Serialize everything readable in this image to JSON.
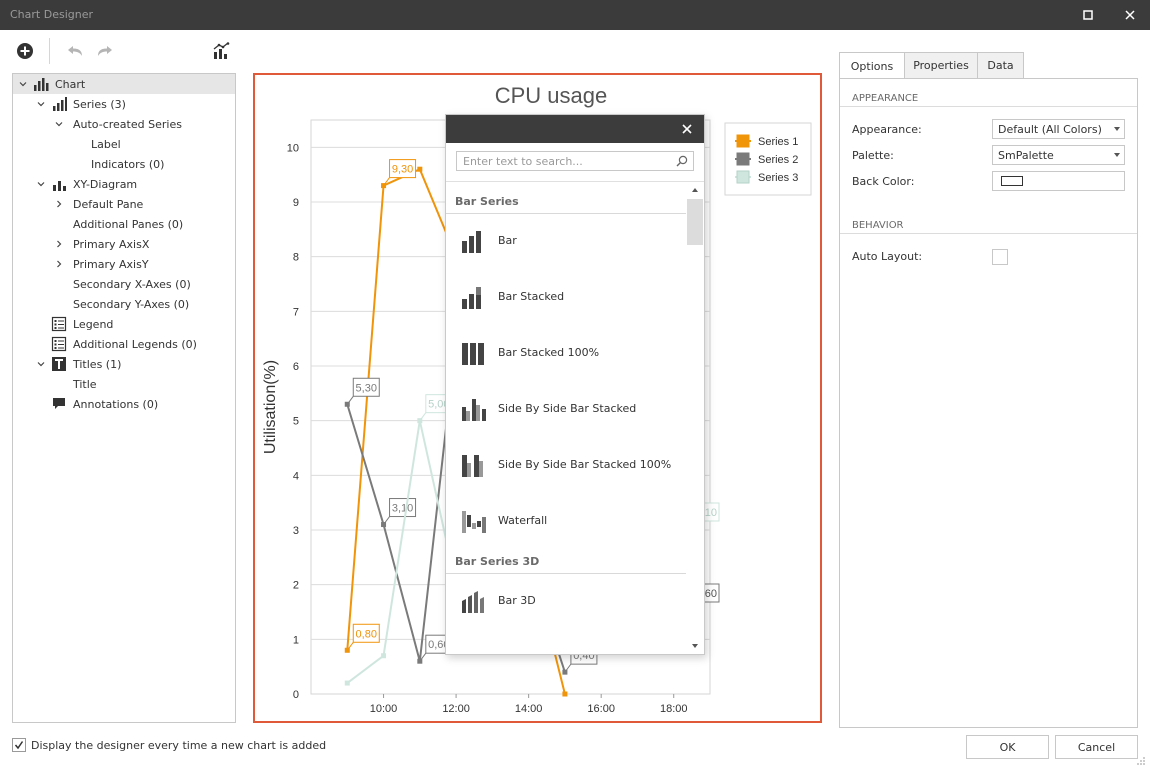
{
  "window": {
    "title": "Chart Designer"
  },
  "tree": {
    "items": [
      {
        "label": "Chart",
        "icon": "chart-icon",
        "level": 0,
        "expanded": true,
        "selected": true
      },
      {
        "label": "Series (3)",
        "icon": "bar-series-icon",
        "level": 1,
        "expanded": true
      },
      {
        "label": "Auto-created Series",
        "icon": "",
        "level": 2,
        "expanded": true
      },
      {
        "label": "Label",
        "icon": "",
        "level": 3
      },
      {
        "label": "Indicators (0)",
        "icon": "",
        "level": 3
      },
      {
        "label": "XY-Diagram",
        "icon": "xy-diagram-icon",
        "level": 1,
        "expanded": true
      },
      {
        "label": "Default Pane",
        "icon": "",
        "level": 2,
        "collapsed": true
      },
      {
        "label": "Additional Panes (0)",
        "icon": "",
        "level": 2
      },
      {
        "label": "Primary AxisX",
        "icon": "",
        "level": 2,
        "collapsed": true
      },
      {
        "label": "Primary AxisY",
        "icon": "",
        "level": 2,
        "collapsed": true
      },
      {
        "label": "Secondary X-Axes (0)",
        "icon": "",
        "level": 2
      },
      {
        "label": "Secondary Y-Axes (0)",
        "icon": "",
        "level": 2
      },
      {
        "label": "Legend",
        "icon": "legend-icon",
        "level": 1
      },
      {
        "label": "Additional Legends (0)",
        "icon": "legend-icon",
        "level": 1
      },
      {
        "label": "Titles (1)",
        "icon": "title-icon",
        "level": 1,
        "expanded": true
      },
      {
        "label": "Title",
        "icon": "",
        "level": 2
      },
      {
        "label": "Annotations (0)",
        "icon": "annotation-icon",
        "level": 1
      }
    ]
  },
  "chart_data": {
    "type": "line",
    "title": "CPU usage",
    "xlabel": "",
    "ylabel": "Utilisation(%)",
    "ylim": [
      0,
      10.5
    ],
    "xlim": [
      8,
      19
    ],
    "yticks": [
      "0",
      "1",
      "2",
      "3",
      "4",
      "5",
      "6",
      "7",
      "8",
      "9",
      "10"
    ],
    "xticks": [
      {
        "v": 10,
        "label": "10:00"
      },
      {
        "v": 12,
        "label": "12:00"
      },
      {
        "v": 14,
        "label": "14:00"
      },
      {
        "v": 16,
        "label": "16:00"
      },
      {
        "v": 18,
        "label": "18:00"
      }
    ],
    "grid": true,
    "legend": "top-right",
    "series": [
      {
        "name": "Series 1",
        "color": "#f0940a",
        "points": [
          {
            "x": 9,
            "y": 0.8,
            "label": "0,80"
          },
          {
            "x": 10,
            "y": 9.3,
            "label": "9,30"
          },
          {
            "x": 11,
            "y": 9.6,
            "label": ""
          },
          {
            "x": 12,
            "y": 8.0,
            "label": ""
          },
          {
            "x": 15,
            "y": 0.0,
            "label": ""
          }
        ]
      },
      {
        "name": "Series 2",
        "color": "#7a7a7a",
        "points": [
          {
            "x": 9,
            "y": 5.3,
            "label": "5,30"
          },
          {
            "x": 10,
            "y": 3.1,
            "label": "3,10"
          },
          {
            "x": 11,
            "y": 0.6,
            "label": "0,60"
          },
          {
            "x": 12,
            "y": 6.5,
            "label": ""
          },
          {
            "x": 15,
            "y": 0.4,
            "label": "0,40"
          }
        ]
      },
      {
        "name": "Series 3",
        "color": "#cfe6df",
        "points": [
          {
            "x": 9,
            "y": 0.2,
            "label": ""
          },
          {
            "x": 10,
            "y": 0.7,
            "label": ""
          },
          {
            "x": 11,
            "y": 5.0,
            "label": "5,00"
          },
          {
            "x": 12,
            "y": 2.0,
            "label": ""
          }
        ]
      }
    ],
    "partial_labels": [
      "10",
      "60"
    ]
  },
  "picker": {
    "search_placeholder": "Enter text to search...",
    "groups": [
      {
        "name": "Bar Series",
        "items": [
          "Bar",
          "Bar Stacked",
          "Bar Stacked 100%",
          "Side By Side Bar Stacked",
          "Side By Side Bar Stacked 100%",
          "Waterfall"
        ]
      },
      {
        "name": "Bar Series 3D",
        "items": [
          "Bar 3D"
        ]
      }
    ]
  },
  "props": {
    "tabs": [
      "Options",
      "Properties",
      "Data"
    ],
    "active_tab": "Options",
    "appearance_section": "APPEARANCE",
    "appearance_label": "Appearance:",
    "appearance_value": "Default (All Colors)",
    "palette_label": "Palette:",
    "palette_value": "SmPalette",
    "backcolor_label": "Back Color:",
    "behavior_section": "BEHAVIOR",
    "autolayout_label": "Auto Layout:"
  },
  "footer": {
    "check_label": "Display the designer every time a new chart is added",
    "ok_label": "OK",
    "cancel_label": "Cancel"
  }
}
